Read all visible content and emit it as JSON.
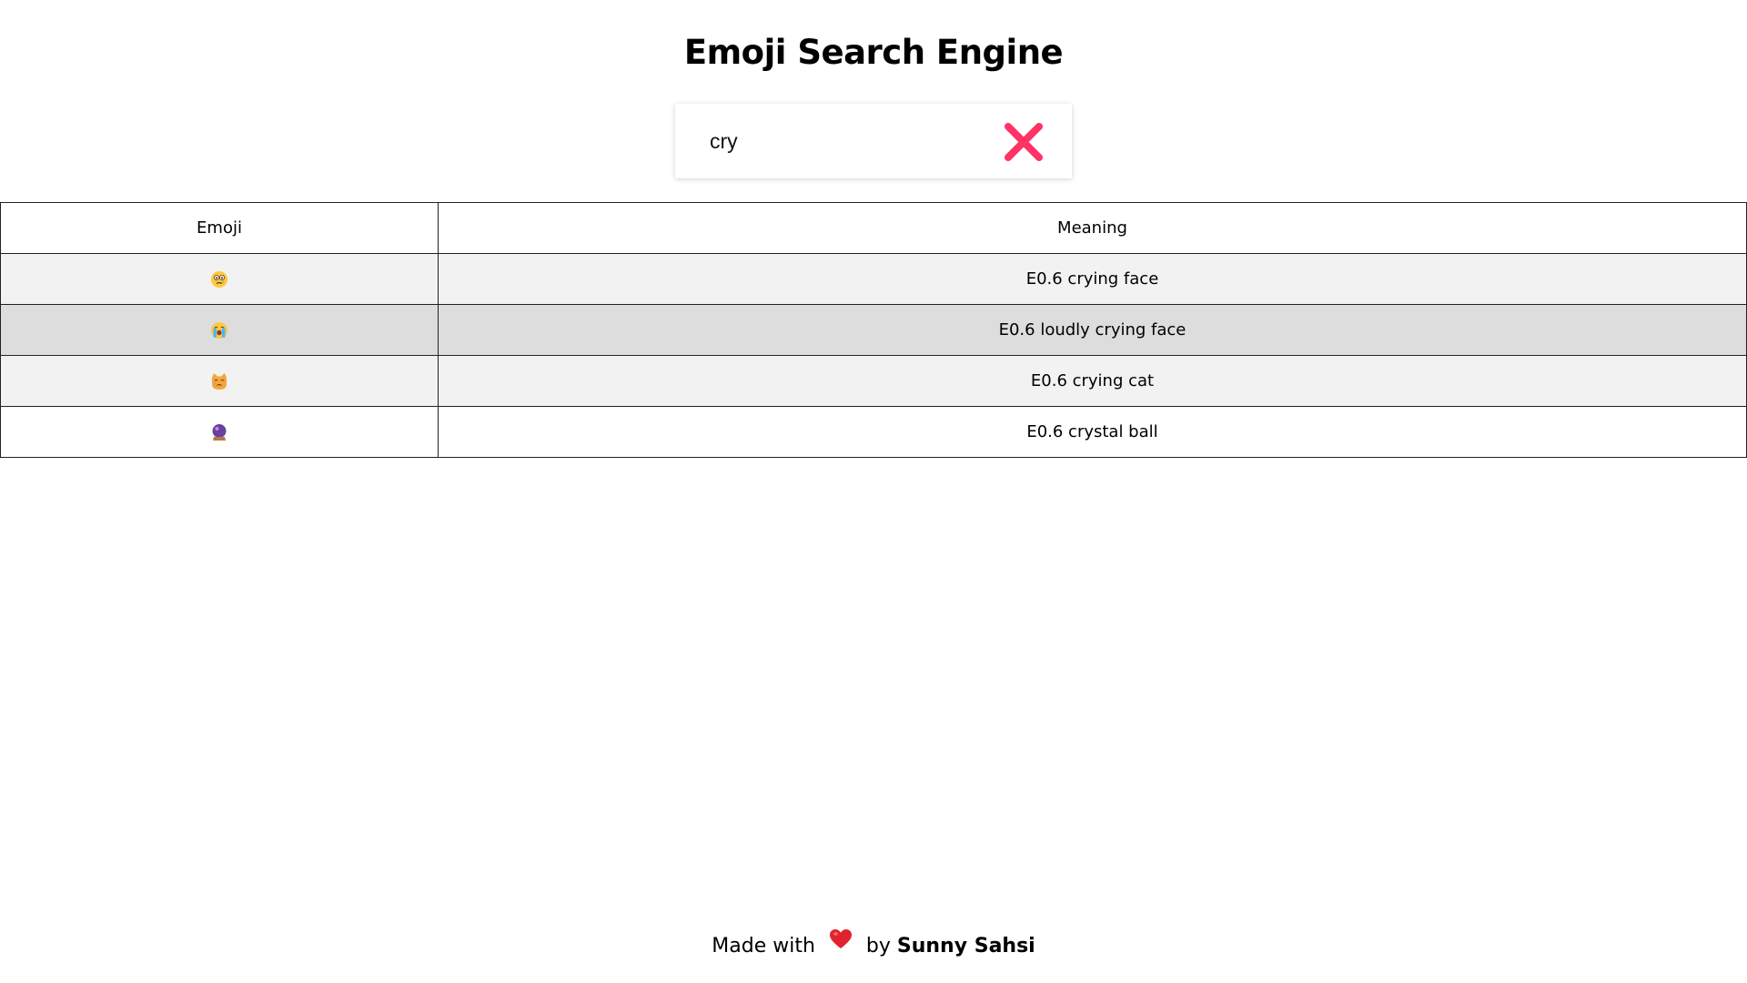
{
  "header": {
    "title": "Emoji Search Engine"
  },
  "search": {
    "value": "cry",
    "placeholder": "",
    "clear_icon": "close-icon",
    "clear_color": "#ff3366"
  },
  "table": {
    "columns": [
      "Emoji",
      "Meaning"
    ],
    "rows": [
      {
        "emoji": "😢",
        "emoji_icon": "crying-face-icon",
        "meaning": "E0.6 crying face"
      },
      {
        "emoji": "😭",
        "emoji_icon": "loudly-crying-face-icon",
        "meaning": "E0.6 loudly crying face"
      },
      {
        "emoji": "😿",
        "emoji_icon": "crying-cat-icon",
        "meaning": "E0.6 crying cat"
      },
      {
        "emoji": "🔮",
        "emoji_icon": "crystal-ball-icon",
        "meaning": "E0.6 crystal ball"
      }
    ]
  },
  "footer": {
    "prefix": "Made with",
    "heart_icon": "heart-icon",
    "by": "by",
    "author": "Sunny Sahsi"
  }
}
